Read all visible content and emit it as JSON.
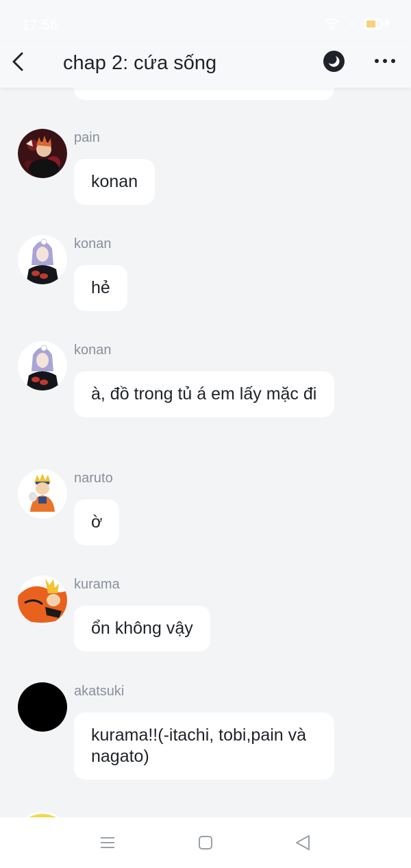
{
  "status_bar": {
    "time": "17:56"
  },
  "header": {
    "title": "chap 2: cứa sống"
  },
  "colors": {
    "background": "#f3f4f6",
    "bubble": "#ffffff",
    "sender": "#8a8f99",
    "akatsuki_red": "#c0392b"
  },
  "messages": [
    {
      "sender": "pain",
      "text": "konan"
    },
    {
      "sender": "konan",
      "text": "hẻ"
    },
    {
      "sender": "konan",
      "text": "à, đồ trong tủ á em lấy mặc đi"
    },
    {
      "sender": "naruto",
      "text": "ờ"
    },
    {
      "sender": "kurama",
      "text": "ổn không vậy"
    },
    {
      "sender": "akatsuki",
      "text": "kurama!!(-itachi, tobi,pain và nagato)"
    }
  ],
  "nav": {
    "icons": [
      "menu-icon",
      "home-square-icon",
      "back-triangle-icon"
    ]
  }
}
